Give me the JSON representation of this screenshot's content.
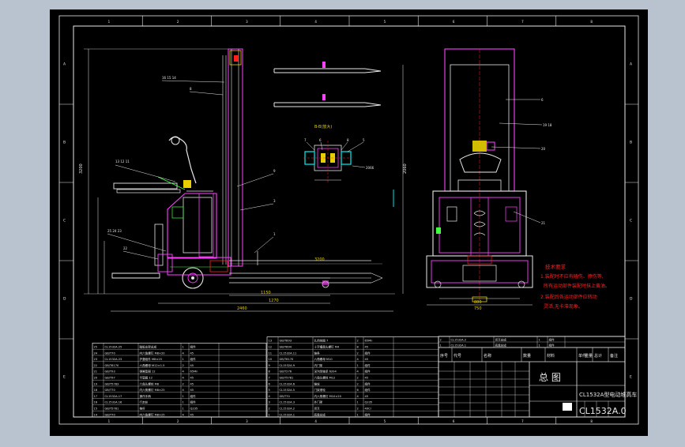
{
  "drawing": {
    "title_big": "总 图",
    "model_name": "CL1532A型电动堆高车",
    "drawing_number": "CL1532A.0",
    "row_labels_left": [
      "A",
      "B",
      "C",
      "D",
      "E"
    ],
    "row_labels_right": [
      "A",
      "B",
      "C",
      "D",
      "E"
    ],
    "col_labels": [
      "1",
      "2",
      "3",
      "4",
      "5",
      "6",
      "7",
      "8"
    ],
    "colors": {
      "background": "#b9c3cf",
      "paper": "#000000",
      "frame": "#ffffff",
      "line_white": "#e8e8e8",
      "line_magenta": "#ff40ff",
      "line_yellow": "#e8d000",
      "line_red": "#ff2020",
      "line_cyan": "#00e0e0",
      "line_green": "#40ff40"
    }
  },
  "section_view": {
    "label": "B-B(放大)",
    "callouts": [
      "7",
      "6",
      "8",
      "5"
    ]
  },
  "tech_requirements": {
    "title": "技术要求",
    "lines": [
      "1.装配时不应有磕伤、擦伤等,",
      "所有运动部件装配时抹上黄油。",
      "2.装配后各运动部件应转动",
      "灵活,无卡滞现象。"
    ]
  },
  "title_block": {
    "header_cells": [
      "序号",
      "代号",
      "名称",
      "数量",
      "材料",
      "单件",
      "总计",
      "备注"
    ],
    "weight_label": "重量"
  },
  "bom_left": {
    "rows": [
      [
        "25",
        "CL1532A.25",
        "踏板支架总成",
        "1",
        "组件"
      ],
      [
        "24",
        "GB/T70",
        "内六角螺钉 M8×20",
        "4",
        "45"
      ],
      [
        "23",
        "CL1532A.23",
        "护罩组件 M8×25",
        "1",
        "组件"
      ],
      [
        "22",
        "GB/T6170",
        "六角螺母 M12×1.5",
        "2",
        "45"
      ],
      [
        "21",
        "GB/T93",
        "弹簧垫圈 12",
        "4",
        "65Mn"
      ],
      [
        "20",
        "GB/T97",
        "平垫圈 12",
        "4",
        "45"
      ],
      [
        "19",
        "GB/T5783",
        "六角头螺栓 M8",
        "2",
        "45"
      ],
      [
        "18",
        "GB/T70",
        "内六角螺钉 M8×25",
        "4",
        "45"
      ],
      [
        "17",
        "CL1532A.17",
        "操作手柄",
        "1",
        "组件"
      ],
      [
        "16",
        "CL1532A.16",
        "行走轮",
        "1",
        "组件"
      ],
      [
        "15",
        "GB/T5781",
        "推杆",
        "1",
        "Q235"
      ],
      [
        "14",
        "GB/T70",
        "内六角螺钉 M8×25",
        "4",
        "45"
      ]
    ]
  },
  "bom_mid": {
    "rows": [
      [
        "13",
        "GB/T893",
        "孔用挡圈 7",
        "2",
        "65Mn"
      ],
      [
        "12",
        "GB/T894",
        "十字槽盘头螺钉 M4",
        "8",
        "45"
      ],
      [
        "11",
        "CL1532A.11",
        "链条",
        "2",
        "组件"
      ],
      [
        "10",
        "GB/T6170",
        "六角螺母 M10",
        "4",
        "45"
      ],
      [
        "9",
        "CL1532A.9",
        "内门架",
        "1",
        "组件"
      ],
      [
        "8",
        "GB/T276",
        "深沟球轴承 6204",
        "4",
        "组件"
      ],
      [
        "7",
        "GB/T5781",
        "六角头螺栓 M12",
        "2",
        "45"
      ],
      [
        "6",
        "CL1532A.6",
        "链轮",
        "2",
        "组件"
      ],
      [
        "5",
        "CL1532A.5",
        "门架滚轮",
        "6",
        "组件"
      ],
      [
        "4",
        "GB/T70",
        "内六角螺钉 M10×20",
        "4",
        "45"
      ],
      [
        "3",
        "CL1532A.3",
        "外门架",
        "1",
        "Q235"
      ],
      [
        "2",
        "CL1532A.2",
        "货叉",
        "2",
        "40Cr"
      ],
      [
        "1",
        "CL1532A.1",
        "底盘总成",
        "1",
        "组件"
      ]
    ]
  },
  "bom_right": {
    "rows": [
      [
        "2",
        "CL1532A.2",
        "货叉总成",
        "1",
        "组件"
      ],
      [
        "1",
        "CL1532A.1",
        "底盘总成",
        "1",
        "组件"
      ]
    ]
  },
  "dimensions": {
    "overall_length": "2460",
    "fork_length": "1150",
    "wheelbase": "1270",
    "lift_height": "3200",
    "mast_height": "2060",
    "width_rear": "880",
    "width_front": "750"
  },
  "side_callouts": [
    "16",
    "15",
    "14",
    "13",
    "12",
    "11",
    "10",
    "9",
    "8",
    "4",
    "3",
    "2",
    "1",
    "25",
    "24",
    "23",
    "22"
  ],
  "front_callouts": [
    "6",
    "19",
    "18",
    "20",
    "21"
  ]
}
